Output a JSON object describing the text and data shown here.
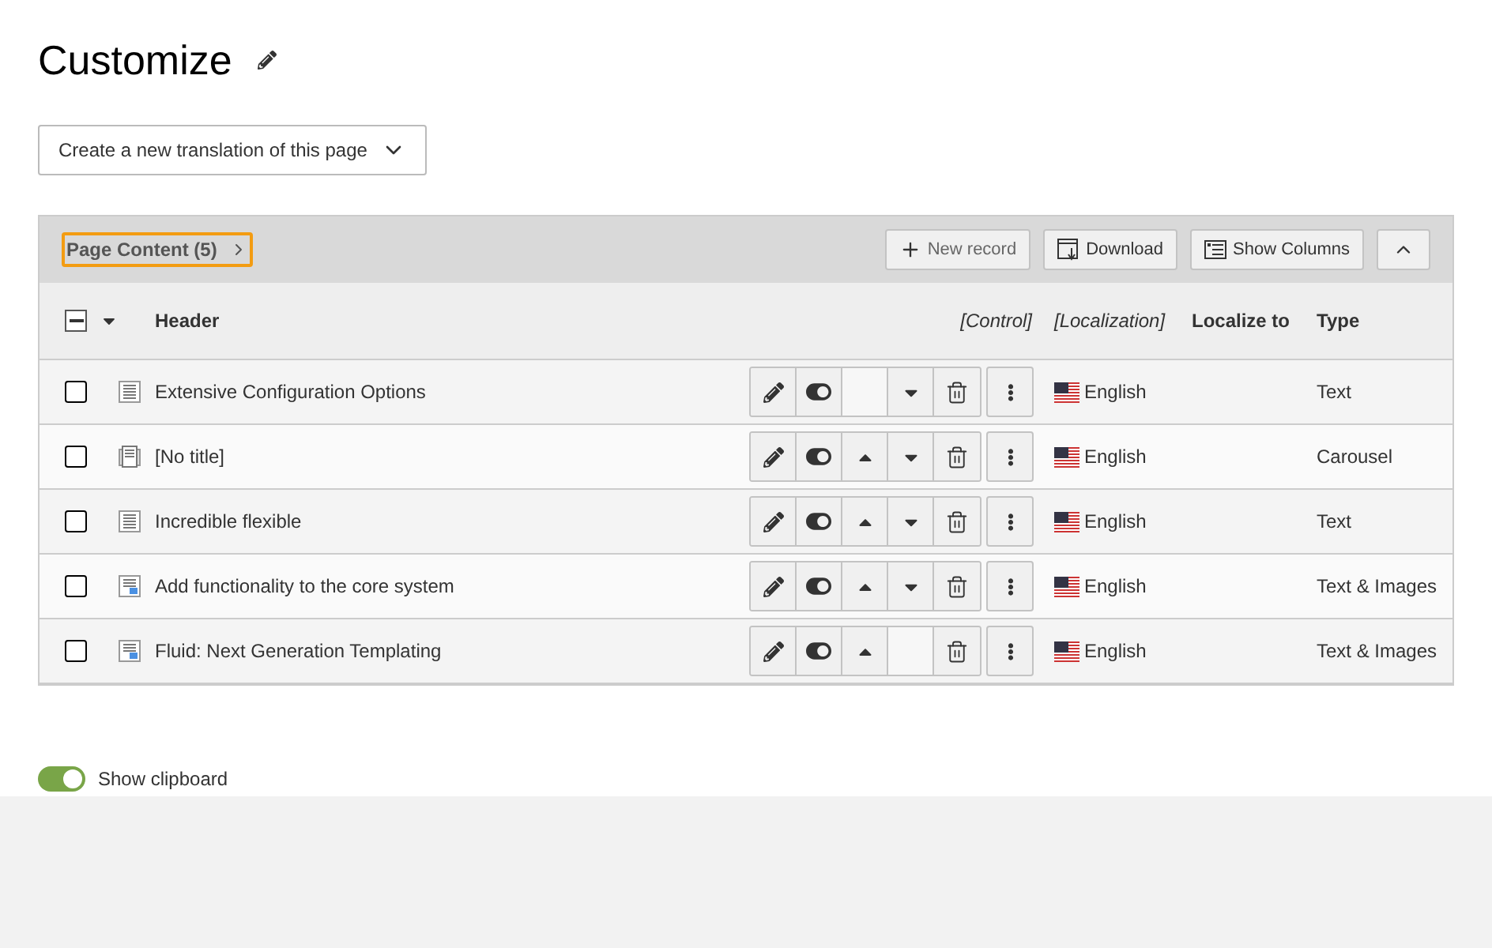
{
  "page": {
    "title": "Customize"
  },
  "translation_select": {
    "value": "Create a new translation of this page"
  },
  "panel": {
    "title": "Page Content (5)",
    "focused": true,
    "toolbar": [
      "New record",
      "Download",
      "Show Columns"
    ],
    "expanded": true
  },
  "table": {
    "select_all_partial": true,
    "columns": [
      "Header",
      "[Control]",
      "[Localization]",
      "Localize to",
      "Type"
    ],
    "rows": [
      {
        "checked": false,
        "kind": "text",
        "title": "Extensive Configuration Options",
        "can_move_up": false,
        "can_move_down": true,
        "language": "English",
        "type": "Text"
      },
      {
        "checked": false,
        "kind": "carousel",
        "title": "[No title]",
        "can_move_up": true,
        "can_move_down": true,
        "language": "English",
        "type": "Carousel"
      },
      {
        "checked": false,
        "kind": "text",
        "title": "Incredible flexible",
        "can_move_up": true,
        "can_move_down": true,
        "language": "English",
        "type": "Text"
      },
      {
        "checked": false,
        "kind": "textmedia",
        "title": "Add functionality to the core system",
        "can_move_up": true,
        "can_move_down": true,
        "language": "English",
        "type": "Text & Images"
      },
      {
        "checked": false,
        "kind": "textmedia",
        "title": "Fluid: Next Generation Templating",
        "can_move_up": true,
        "can_move_down": false,
        "language": "English",
        "type": "Text & Images"
      }
    ]
  },
  "clipboard": {
    "label": "Show clipboard",
    "on": true
  }
}
